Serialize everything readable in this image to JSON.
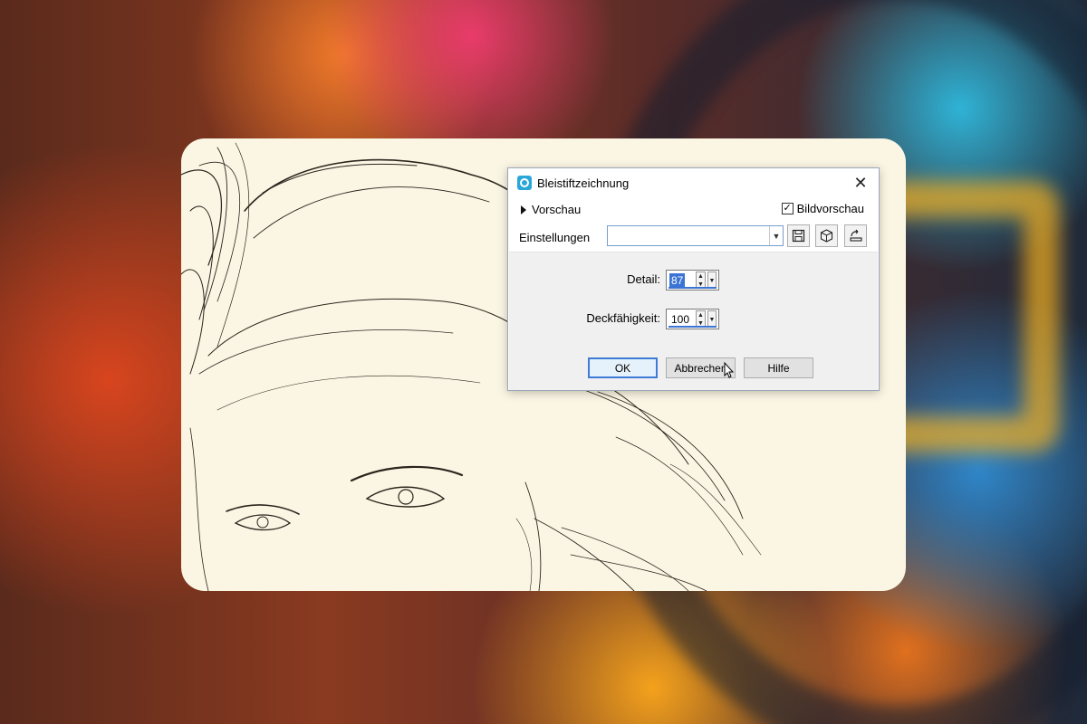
{
  "dialog": {
    "title": "Bleistiftzeichnung",
    "close_icon": "close-icon",
    "preview_label": "Vorschau",
    "image_preview_label": "Bildvorschau",
    "image_preview_checked": true,
    "settings_label": "Einstellungen",
    "settings_value": "",
    "tool_icons": [
      "save-icon",
      "cube-icon",
      "reset-icon"
    ],
    "detail_label": "Detail:",
    "detail_value": "87",
    "opacity_label": "Deckfähigkeit:",
    "opacity_value": "100",
    "ok_label": "OK",
    "cancel_label": "Abbrechen",
    "help_label": "Hilfe"
  },
  "colors": {
    "accent": "#3d7bd6",
    "sketch_paper": "#fbf6e4",
    "selection": "#3b74d4"
  }
}
